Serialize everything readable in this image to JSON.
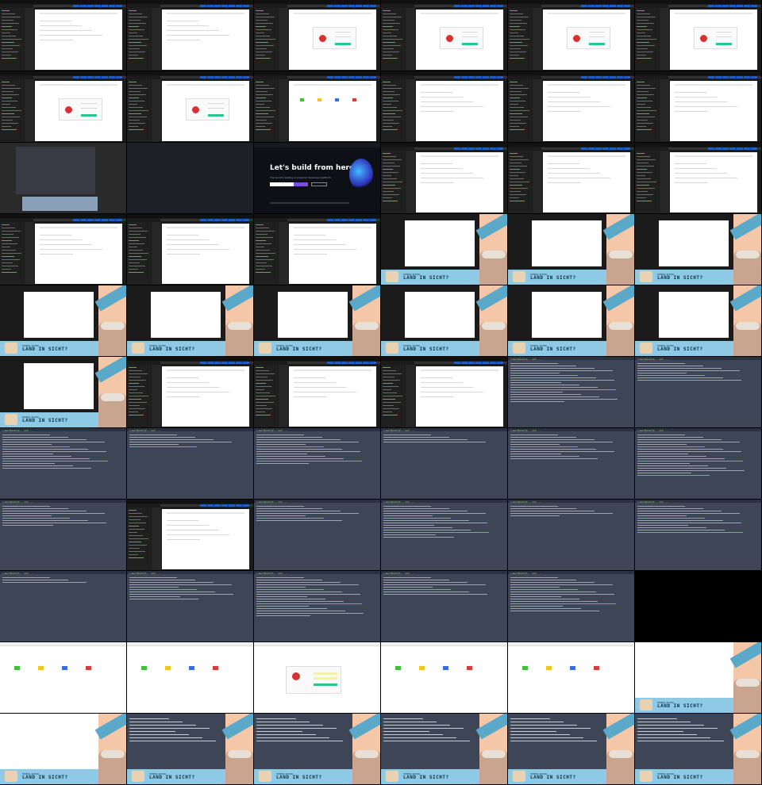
{
  "grid": {
    "columns": 6,
    "rows": 11
  },
  "github": {
    "hero_title": "Let's build from here",
    "subtitle": "The world's leading AI-powered developer platform."
  },
  "overlay": {
    "title": "LAND IN SICHT?",
    "subtitle": "FRIEDL SHOW"
  },
  "terminal": {
    "prompt": "[user@host]$ ~ ssh ..."
  },
  "tiles": [
    "ide",
    "ide",
    "ide-login",
    "ide-login",
    "ide-login",
    "ide-login",
    "ide-login",
    "ide-login",
    "ide-dash",
    "ide",
    "ide",
    "ide",
    "yt",
    "blank",
    "github",
    "ide",
    "ide",
    "ide",
    "ide",
    "ide",
    "ide",
    "overlay",
    "overlay",
    "overlay",
    "overlay",
    "overlay",
    "overlay",
    "overlay",
    "overlay",
    "overlay",
    "overlay",
    "ide",
    "ide",
    "ide",
    "term",
    "term",
    "term",
    "term",
    "term",
    "term",
    "term",
    "term",
    "term",
    "ide",
    "term",
    "term",
    "term",
    "term",
    "term",
    "term",
    "term",
    "term",
    "term",
    "black",
    "web",
    "web",
    "web-login",
    "web",
    "web",
    "overlay-web",
    "overlay-web",
    "overlay-term",
    "overlay-term",
    "overlay-term",
    "overlay-term",
    "overlay-term"
  ]
}
